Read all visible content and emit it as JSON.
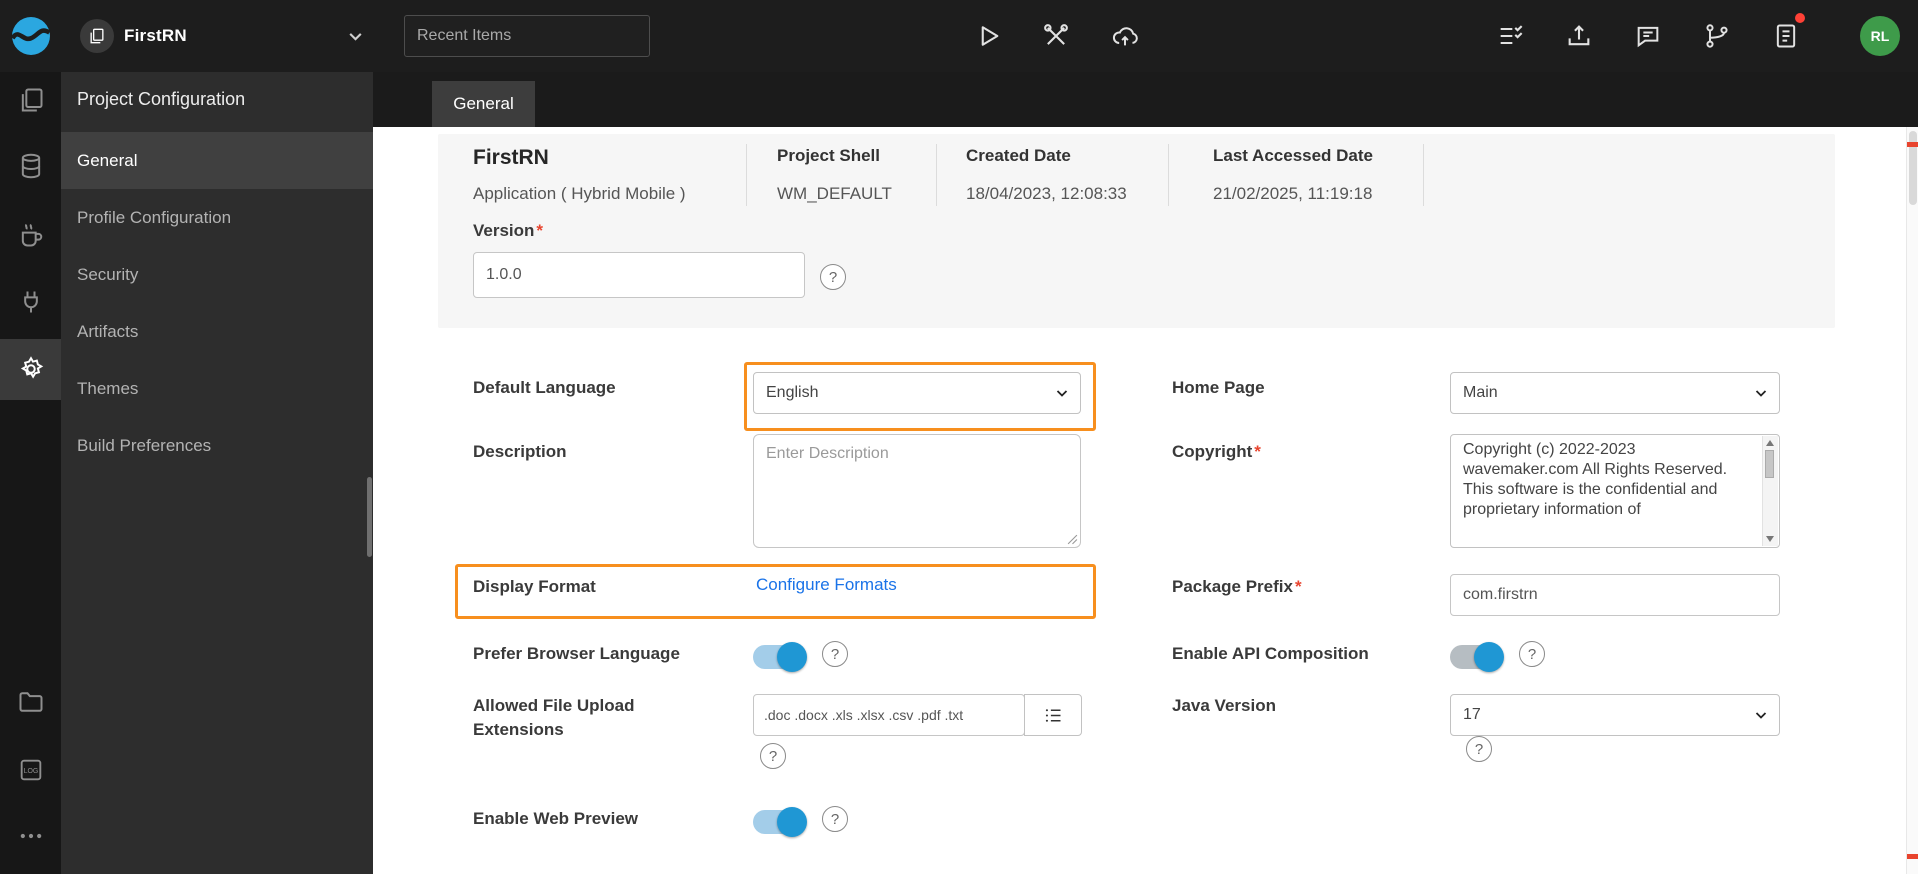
{
  "topbar": {
    "project_name": "FirstRN",
    "recent_items_placeholder": "Recent Items",
    "avatar_initials": "RL"
  },
  "tabs": [
    {
      "label": "General"
    }
  ],
  "sidebar": {
    "title": "Project Configuration",
    "items": [
      {
        "label": "General",
        "active": true
      },
      {
        "label": "Profile Configuration",
        "active": false
      },
      {
        "label": "Security",
        "active": false
      },
      {
        "label": "Artifacts",
        "active": false
      },
      {
        "label": "Themes",
        "active": false
      },
      {
        "label": "Build Preferences",
        "active": false
      }
    ]
  },
  "info": {
    "title": "FirstRN",
    "subtitle": "Application ( Hybrid Mobile )",
    "stats": [
      {
        "label": "Project Shell",
        "value": "WM_DEFAULT"
      },
      {
        "label": "Created Date",
        "value": "18/04/2023, 12:08:33"
      },
      {
        "label": "Last Accessed Date",
        "value": "21/02/2025, 11:19:18"
      }
    ],
    "version_label": "Version",
    "version_value": "1.0.0"
  },
  "form": {
    "default_language": {
      "label": "Default Language",
      "value": "English"
    },
    "home_page": {
      "label": "Home Page",
      "value": "Main"
    },
    "description": {
      "label": "Description",
      "placeholder": "Enter Description"
    },
    "copyright": {
      "label": "Copyright",
      "value": "Copyright (c) 2022-2023\nwavemaker.com All Rights Reserved.\n This software is the confidential and\nproprietary information of"
    },
    "display_format": {
      "label": "Display Format",
      "link": "Configure Formats"
    },
    "package_prefix": {
      "label": "Package Prefix",
      "value": "com.firstrn"
    },
    "prefer_browser_language": {
      "label": "Prefer Browser Language",
      "enabled": true
    },
    "enable_api_composition": {
      "label": "Enable API Composition",
      "enabled": true
    },
    "allowed_file_upload": {
      "label": "Allowed File Upload Extensions",
      "value": ".doc .docx .xls .xlsx .csv .pdf .txt"
    },
    "java_version": {
      "label": "Java Version",
      "value": "17"
    },
    "enable_web_preview": {
      "label": "Enable Web Preview",
      "enabled": true
    }
  },
  "glyphs": {
    "required": "*",
    "help": "?"
  },
  "icons": {
    "wavemaker-logo": "blue wave circle",
    "project-icon": "stacked pages",
    "chevron-down-icon": "v chevron",
    "run-icon": "play triangle outline",
    "tools-icon": "crossed tools",
    "deploy-icon": "cloud upload",
    "checklist-icon": "list with checkmarks",
    "export-icon": "arrow up from tray",
    "feedback-icon": "speech bubble",
    "git-branch-icon": "branch nodes",
    "report-icon": "document with lines + red dot",
    "pages-icon": "overlapping pages",
    "database-icon": "cylinder",
    "java-services-icon": "coffee cup",
    "apis-icon": "plug",
    "settings-gear-icon": "gear (active)",
    "folder-icon": "folder outline",
    "logs-icon": "square labelled LOG",
    "more-options-icon": "three dots",
    "help-icon": "question mark circle",
    "list-icon": "bulleted list"
  },
  "colors": {
    "highlight_orange": "#F78F1E",
    "link_blue": "#1A73E8",
    "toggle_blue": "#1F97D4",
    "avatar_green": "#3E9B4A",
    "alert_red": "#E8442E"
  }
}
